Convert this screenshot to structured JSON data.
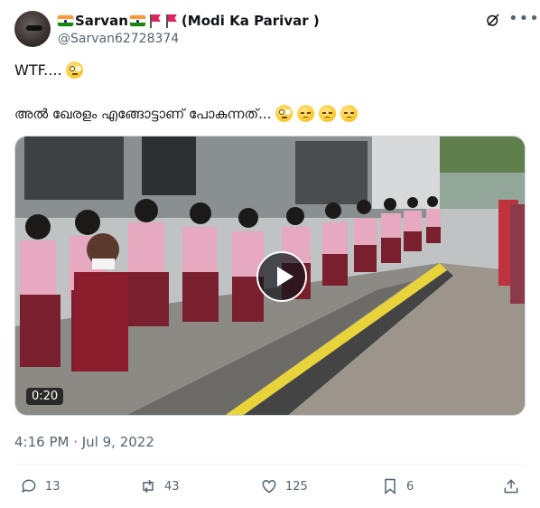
{
  "user": {
    "display_name": "Sarvan",
    "display_suffix": "(Modi Ka Parivar )",
    "handle": "@Sarvan62728374"
  },
  "tweet": {
    "line1": "WTF....",
    "line2": "അൽ ഖേരളം എങ്ങോട്ടാണ് പോകുന്നത്..."
  },
  "media": {
    "duration": "0:20"
  },
  "meta": {
    "timestamp": "4:16 PM · Jul 9, 2022"
  },
  "actions": {
    "replies": "13",
    "retweets": "43",
    "likes": "125",
    "bookmarks": "6"
  },
  "icons": [
    "grok-icon",
    "more-icon",
    "reply-icon",
    "retweet-icon",
    "like-icon",
    "bookmark-icon",
    "share-icon",
    "play-icon"
  ],
  "colors": {
    "text": "#0f1419",
    "secondary": "#536471",
    "border": "#cfd9de"
  }
}
